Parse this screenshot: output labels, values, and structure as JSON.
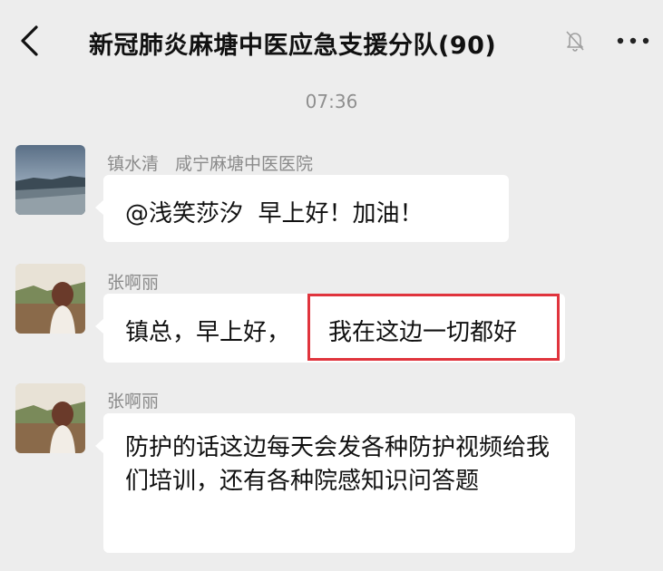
{
  "header": {
    "title": "新冠肺炎麻塘中医应急支援分队(90)"
  },
  "icons": {
    "back": "chevron-left-icon",
    "mute": "bell-off-icon",
    "more": "more-dots-icon"
  },
  "chat": {
    "timestamp": "07:36",
    "messages": [
      {
        "sender": "镇水清",
        "org": "咸宁麻塘中医医院",
        "text": "@浅笑莎汐  早上好！加油！"
      },
      {
        "sender": "张啊丽",
        "text_part1": "镇总，早上好，",
        "text_part2": "我在这边一切都好"
      },
      {
        "sender": "张啊丽",
        "text": "防护的话这边每天会发各种防护视频给我们培训，还有各种院感知识问答题"
      }
    ]
  },
  "colors": {
    "background": "#ededed",
    "bubble": "#ffffff",
    "highlight_border": "#e0343d"
  }
}
